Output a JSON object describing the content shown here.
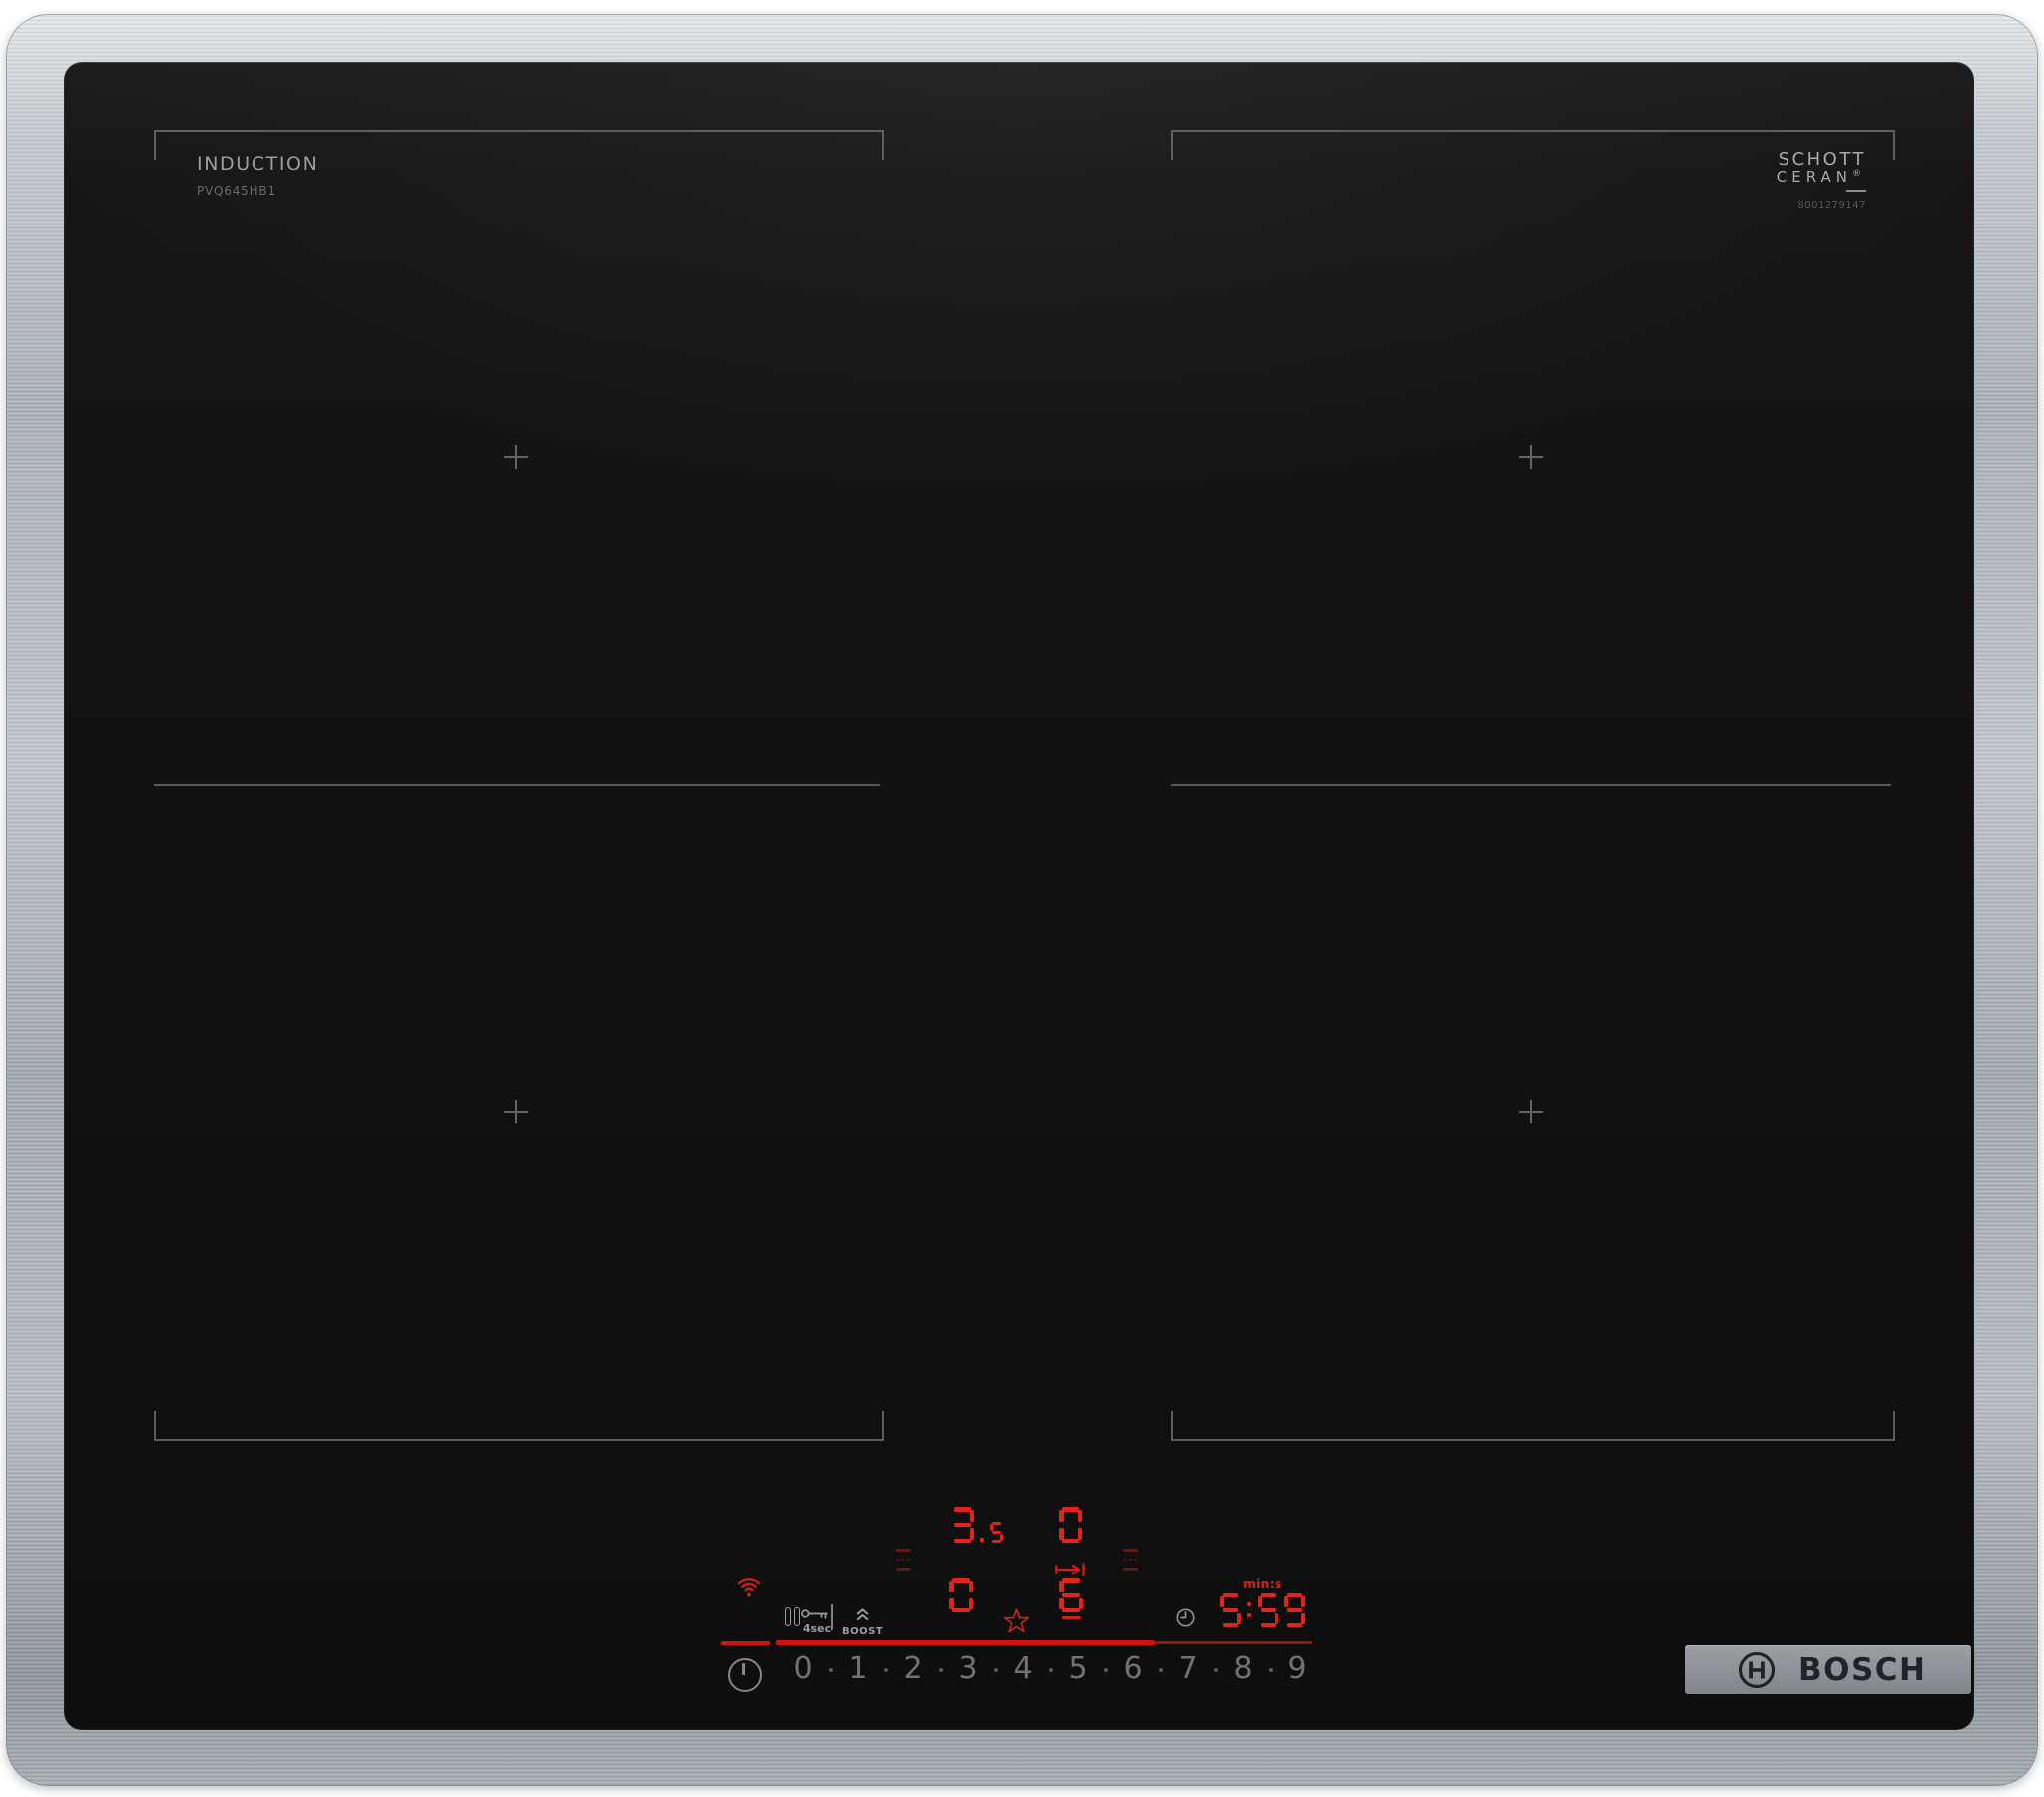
{
  "branding": {
    "induction_label": "INDUCTION",
    "model_number": "PVQ645HB1",
    "glass_brand_line1": "SCHOTT",
    "glass_brand_line2": "CERAN",
    "glass_brand_reg": "®",
    "serial_number": "8001279147",
    "logo_text": "BOSCH"
  },
  "panel": {
    "lock_time_label": "4sec",
    "boost_label": "BOOST",
    "timer_unit_label": "min:s",
    "slider": [
      "0",
      "1",
      "2",
      "3",
      "4",
      "5",
      "6",
      "7",
      "8",
      "9"
    ],
    "displays": {
      "rear_left": "3.5",
      "rear_right": "0",
      "front_left": "0",
      "front_right": "6",
      "timer": "5:59"
    }
  },
  "colors": {
    "display_red": "#e2231a",
    "bar_red": "#d21208",
    "steel": "#b6bbc1",
    "glass_black": "#121212",
    "zone_line_grey": "#6a6c6c",
    "panel_grey": "#9b9da0",
    "slider_grey": "#707274"
  }
}
